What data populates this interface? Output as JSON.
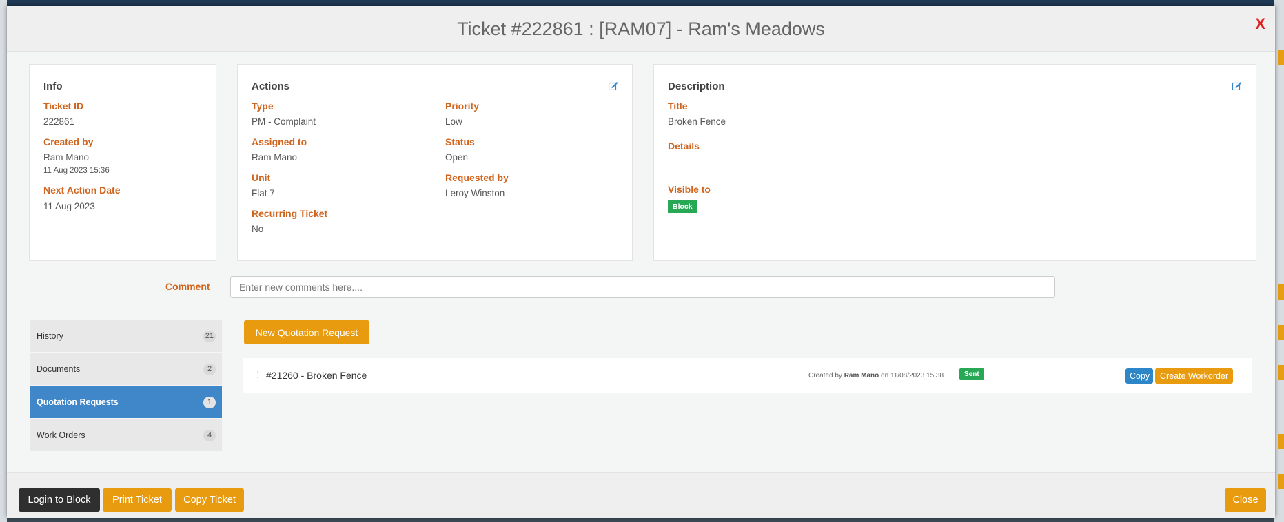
{
  "modal": {
    "title": "Ticket #222861 : [RAM07] - Ram's Meadows",
    "close_x": "X"
  },
  "info": {
    "heading": "Info",
    "ticket_id_label": "Ticket ID",
    "ticket_id": "222861",
    "created_by_label": "Created by",
    "created_by": "Ram Mano",
    "created_at": "11 Aug 2023 15:36",
    "next_action_label": "Next Action Date",
    "next_action": "11 Aug 2023"
  },
  "actions": {
    "heading": "Actions",
    "type_label": "Type",
    "type": "PM - Complaint",
    "priority_label": "Priority",
    "priority": "Low",
    "assigned_label": "Assigned to",
    "assigned": "Ram Mano",
    "status_label": "Status",
    "status": "Open",
    "unit_label": "Unit",
    "unit": "Flat 7",
    "requested_label": "Requested by",
    "requested": "Leroy Winston",
    "recurring_label": "Recurring Ticket",
    "recurring": "No"
  },
  "description": {
    "heading": "Description",
    "title_label": "Title",
    "title": "Broken Fence",
    "details_label": "Details",
    "visible_label": "Visible to",
    "visible_badge": "Block"
  },
  "comment": {
    "label": "Comment",
    "placeholder": "Enter new comments here...."
  },
  "sidebar": {
    "items": [
      {
        "label": "History",
        "count": "21"
      },
      {
        "label": "Documents",
        "count": "2"
      },
      {
        "label": "Quotation Requests",
        "count": "1"
      },
      {
        "label": "Work Orders",
        "count": "4"
      }
    ]
  },
  "quotes": {
    "new_button": "New Quotation Request",
    "row": {
      "title": "#21260 - Broken Fence",
      "created_prefix": "Created by",
      "created_by": "Ram Mano",
      "created_on": "on 11/08/2023 15:38",
      "status": "Sent",
      "copy_button": "Copy",
      "workorder_button": "Create Workorder"
    }
  },
  "footer": {
    "login": "Login to Block",
    "print": "Print Ticket",
    "copy": "Copy Ticket",
    "close": "Close"
  },
  "colors": {
    "accent_orange": "#e99b10",
    "label_orange": "#d0641c",
    "active_blue": "#3f87c8",
    "badge_green": "#28a855"
  }
}
